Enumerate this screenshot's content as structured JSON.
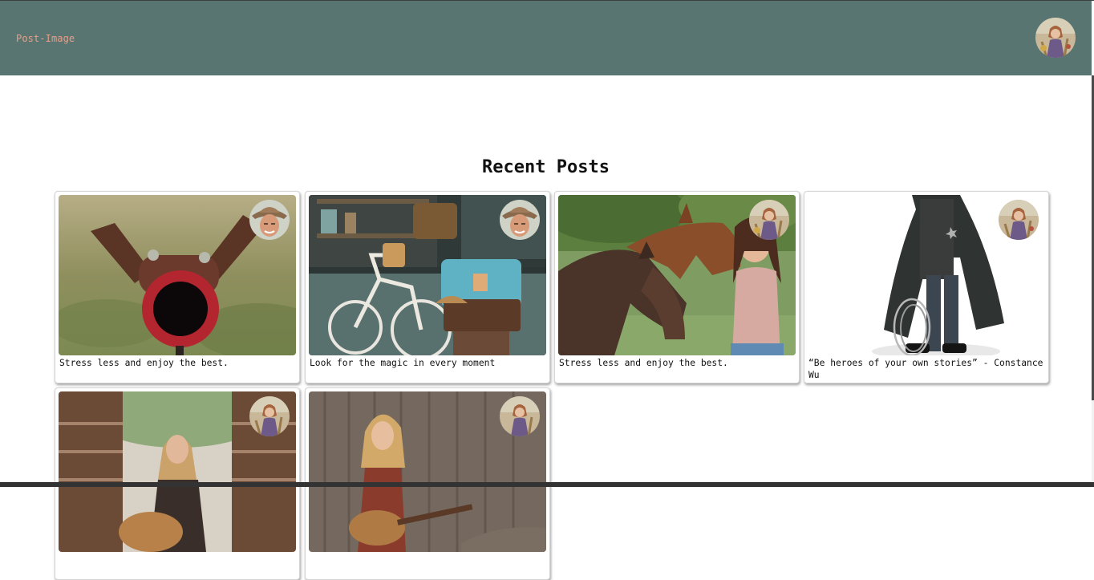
{
  "theme": {
    "header_bg": "#597571",
    "brand_color": "#e89f88"
  },
  "header": {
    "brand": "Post-Image",
    "avatar_icon": "user-avatar"
  },
  "main": {
    "title": "Recent Posts",
    "posts": [
      {
        "caption": "Stress less and enjoy the best.",
        "image": "rusty-metal-deer-sculpture",
        "avatar": "man-in-cowboy-hat"
      },
      {
        "caption": "Look for the magic in every moment",
        "image": "bicycle-and-vintage-suitcase",
        "avatar": "man-in-cowboy-hat"
      },
      {
        "caption": "Stress less and enjoy the best.",
        "image": "woman-with-two-horses",
        "avatar": "woman-portrait"
      },
      {
        "caption": "“Be heroes of your own stories” - Constance Wu",
        "image": "cowboy-in-long-coat-with-rope",
        "avatar": "woman-portrait"
      },
      {
        "caption": "",
        "image": "woman-with-guitar-by-fence",
        "avatar": "woman-portrait"
      },
      {
        "caption": "",
        "image": "woman-playing-guitar-wooden-wall",
        "avatar": "woman-portrait"
      }
    ]
  }
}
